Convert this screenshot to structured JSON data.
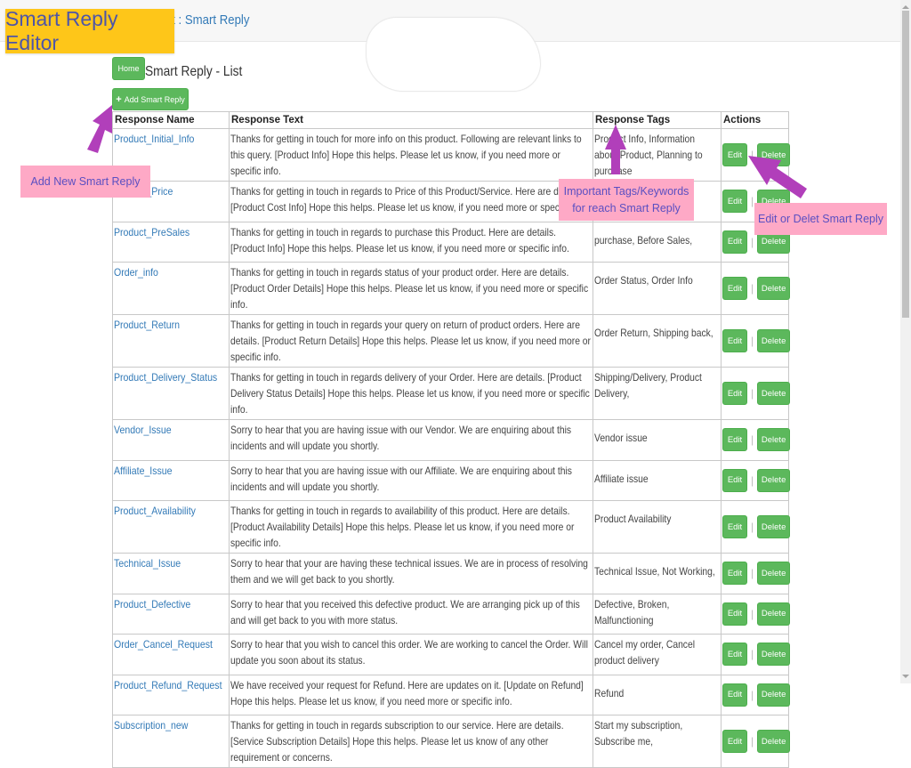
{
  "navbar": {
    "brand": "gent Assist : Smart Reply"
  },
  "page": {
    "home_label": "Home",
    "title": "Smart Reply - List",
    "add_label": "Add Smart Reply",
    "add_icon": "plus-icon"
  },
  "table": {
    "headers": [
      "Response Name",
      "Response Text",
      "Response Tags",
      "Actions"
    ],
    "edit_label": "Edit",
    "delete_label": "Delete",
    "separator": "|",
    "rows": [
      {
        "name": "Product_Initial_Info",
        "text": "Thanks for getting in touch for more info on this product. Following are relevant links to this query. [Product Info] Hope this helps. Please let us know, if you need more or specific info.",
        "tags": "Product Info, Information about Product, Planning to purchase"
      },
      {
        "name": "Product_Price",
        "text": "Thanks for getting in touch in regards to Price of this Product/Service. Here are details. [Product Cost Info] Hope this helps. Please let us know, if you need more or specific info.",
        "tags": ""
      },
      {
        "name": "Product_PreSales",
        "text": "Thanks for getting in touch in regards to purchase this Product. Here are details. [Product Info] Hope this helps. Please let us know, if you need more or specific info.",
        "tags": "purchase, Before Sales,"
      },
      {
        "name": "Order_info",
        "text": "Thanks for getting in touch in regards status of your product order. Here are details. [Product Order Details] Hope this helps. Please let us know, if you need more or specific info.",
        "tags": "Order Status, Order Info"
      },
      {
        "name": "Product_Return",
        "text": "Thanks for getting in touch in regards your query on return of product orders. Here are details. [Product Return Details] Hope this helps. Please let us know, if you need more or specific info.",
        "tags": "Order Return, Shipping back,"
      },
      {
        "name": "Product_Delivery_Status",
        "text": "Thanks for getting in touch in regards delivery of your Order. Here are details. [Product Delivery Status Details] Hope this helps. Please let us know, if you need more or specific info.",
        "tags": "Shipping/Delivery, Product Delivery,"
      },
      {
        "name": "Vendor_Issue",
        "text": "Sorry to hear that you are having issue with our Vendor. We are enquiring about this incidents and will update you shortly.",
        "tags": "Vendor issue"
      },
      {
        "name": "Affiliate_Issue",
        "text": "Sorry to hear that you are having issue with our Affiliate. We are enquiring about this incidents and will update you shortly.",
        "tags": "Affiliate issue"
      },
      {
        "name": "Product_Availability",
        "text": "Thanks for getting in touch in regards to availability of this product. Here are details. [Product Availability Details] Hope this helps. Please let us know, if you need more or specific info.",
        "tags": "Product Availability"
      },
      {
        "name": "Technical_Issue",
        "text": "Sorry to hear that your are having these technical issues. We are in process of resolving them and we will get back to you shortly.",
        "tags": "Technical Issue, Not Working,"
      },
      {
        "name": "Product_Defective",
        "text": "Sorry to hear that you received this defective product. We are arranging pick up of this and will get back to you with more status.",
        "tags": "Defective, Broken, Malfunctioning"
      },
      {
        "name": "Order_Cancel_Request",
        "text": "Sorry to hear that you wish to cancel this order. We are working to cancel the Order. Will update you soon about its status.",
        "tags": "Cancel my order, Cancel product delivery"
      },
      {
        "name": "Product_Refund_Request",
        "text": "We have received your request for Refund. Here are updates on it. [Update on Refund] Hope this helps. Please let us know, if you need more or specific info.",
        "tags": "Refund"
      },
      {
        "name": "Subscription_new",
        "text": "Thanks for getting in touch in regards subscription to our service. Here are details. [Service Subscription Details] Hope this helps. Please let us know of any other requirement or concerns.",
        "tags": "Start my subscription, Subscribe me,"
      }
    ]
  },
  "annotations": {
    "editor_label": "Smart Reply Editor",
    "add_new": "Add New Smart Reply",
    "tags_note": "Important Tags/Keywords for reach Smart Reply",
    "edit_delete": "Edit or Delet Smart Reply"
  },
  "colors": {
    "accent_green": "#5cb85c",
    "link_blue": "#337ab7",
    "annotation_yellow": "#fec619",
    "annotation_pink": "#fea9c6",
    "arrow_purple": "#b13fba"
  }
}
